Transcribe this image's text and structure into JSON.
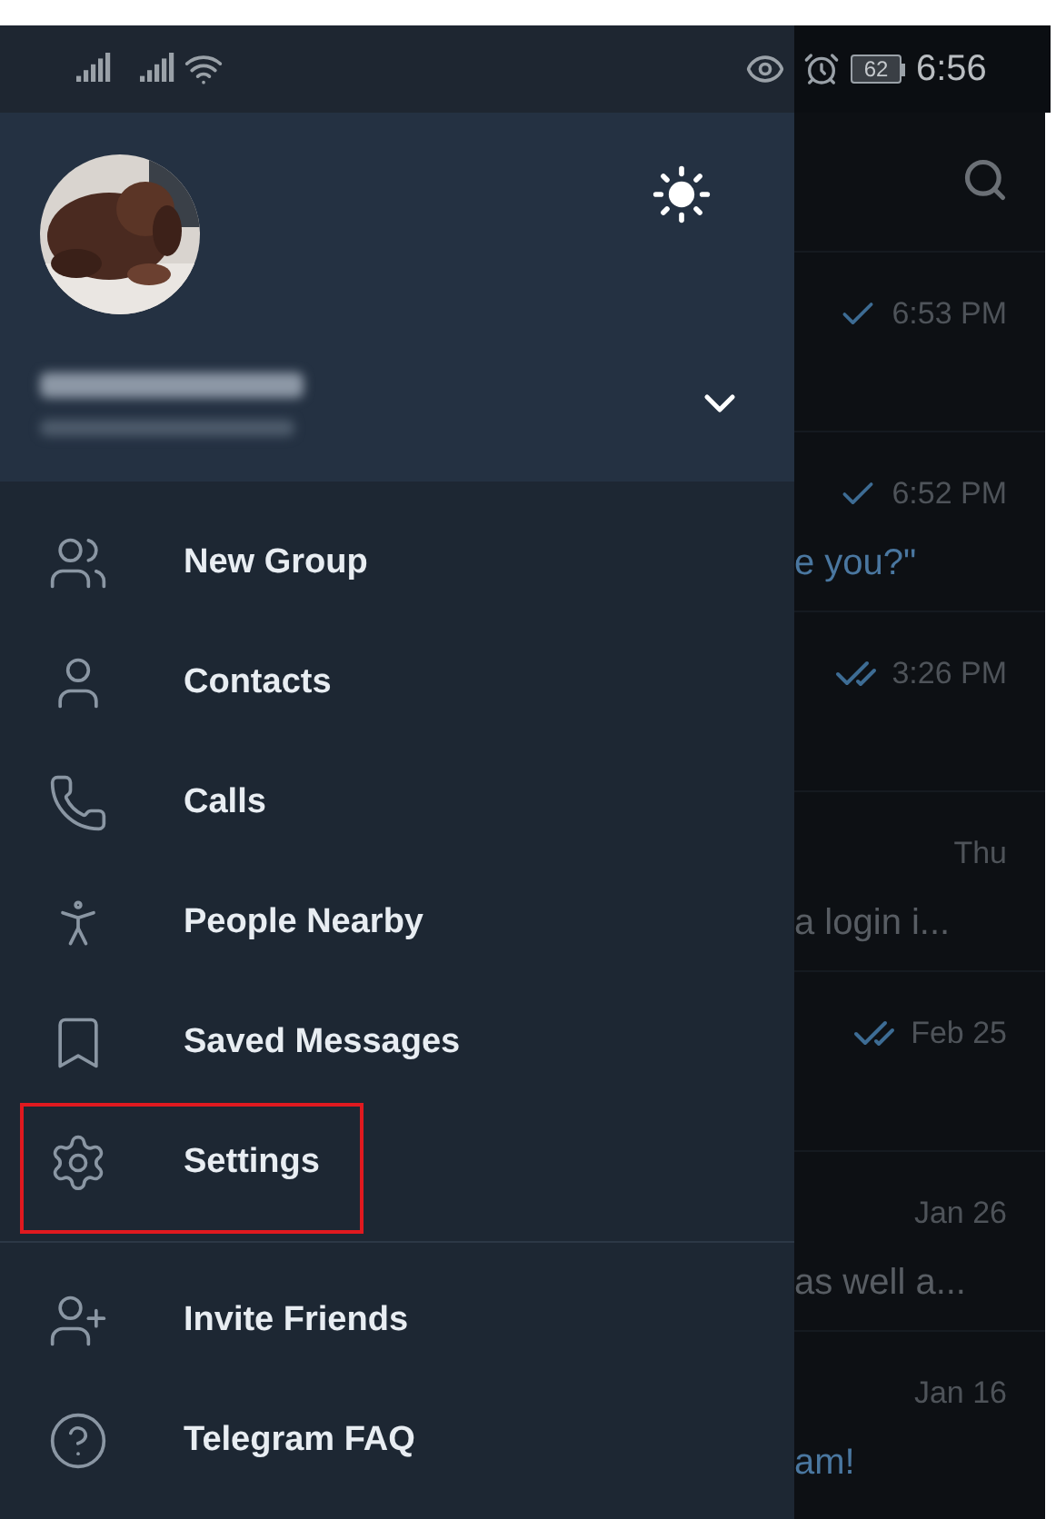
{
  "status_bar": {
    "battery": "62",
    "time": "6:56"
  },
  "drawer": {
    "menu": [
      {
        "label": "New Group",
        "highlighted": false
      },
      {
        "label": "Contacts",
        "highlighted": false
      },
      {
        "label": "Calls",
        "highlighted": false
      },
      {
        "label": "People Nearby",
        "highlighted": false
      },
      {
        "label": "Saved Messages",
        "highlighted": false
      },
      {
        "label": "Settings",
        "highlighted": true
      }
    ],
    "secondary": [
      {
        "label": "Invite Friends",
        "highlighted": false
      },
      {
        "label": "Telegram FAQ",
        "highlighted": false
      }
    ]
  },
  "chats": [
    {
      "time": "6:53 PM",
      "kind": "sent"
    },
    {
      "time": "6:52 PM",
      "kind": "sent",
      "preview": "e you?\"",
      "color": "#4a77a0"
    },
    {
      "time": "3:26 PM",
      "kind": "read"
    },
    {
      "time": "Thu",
      "kind": "none",
      "preview": "a login i...",
      "color": "#585d63"
    },
    {
      "time": "Feb 25",
      "kind": "read"
    },
    {
      "time": "Jan 26",
      "kind": "none",
      "preview": "as well a...",
      "color": "#585d63"
    },
    {
      "time": "Jan 16",
      "kind": "none",
      "preview": "am!",
      "color": "#4a77a0"
    }
  ]
}
